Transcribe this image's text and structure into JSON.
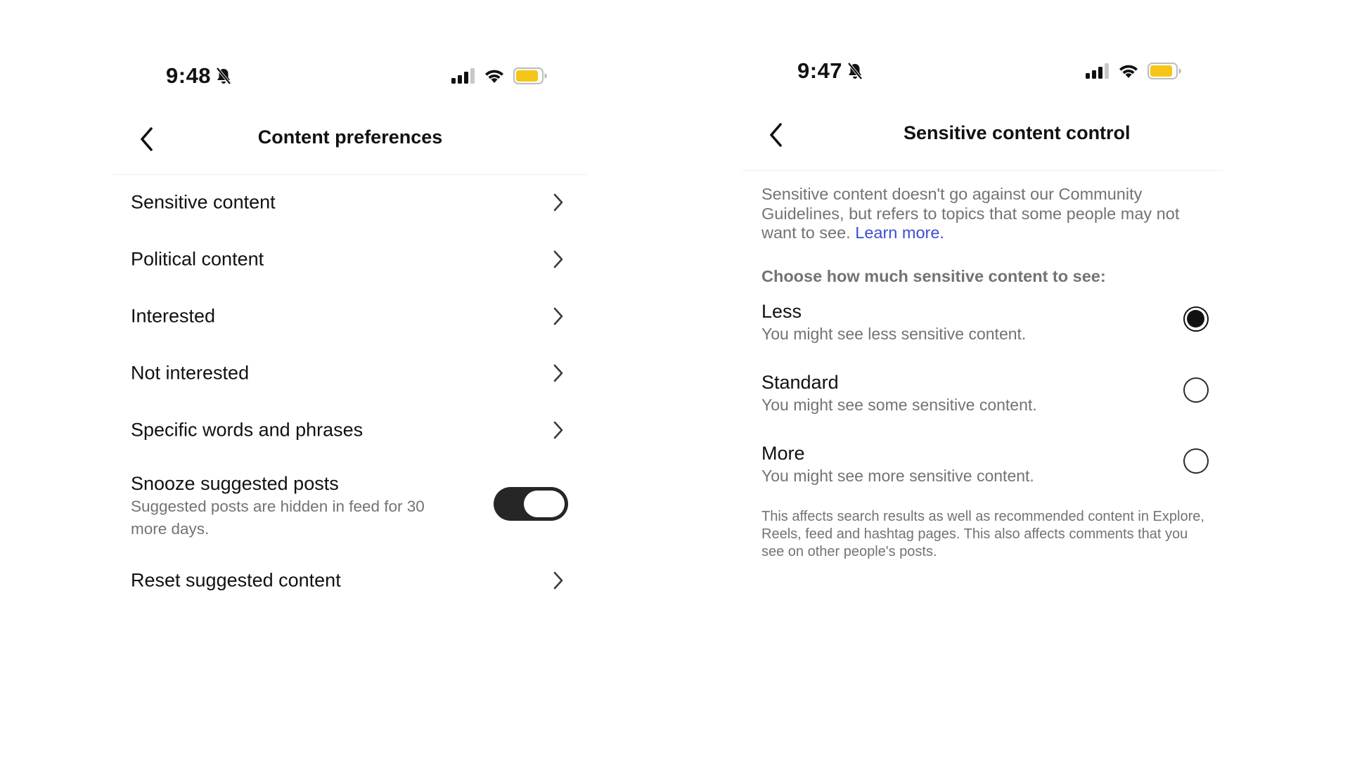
{
  "left_screen": {
    "status_bar": {
      "time": "9:48",
      "icons": [
        "bell-slash-icon",
        "signal-icon",
        "wifi-icon",
        "battery-icon"
      ]
    },
    "header": {
      "back_icon": "chevron-left-icon",
      "title": "Content preferences"
    },
    "items": [
      {
        "label": "Sensitive content"
      },
      {
        "label": "Political content"
      },
      {
        "label": "Interested"
      },
      {
        "label": "Not interested"
      },
      {
        "label": "Specific words and phrases"
      }
    ],
    "snooze": {
      "title": "Snooze suggested posts",
      "subtitle": "Suggested posts are hidden in feed for 30 more days.",
      "toggle_on": true
    },
    "reset": {
      "label": "Reset suggested content"
    }
  },
  "right_screen": {
    "status_bar": {
      "time": "9:47",
      "icons": [
        "bell-slash-icon",
        "signal-icon",
        "wifi-icon",
        "battery-icon"
      ]
    },
    "header": {
      "back_icon": "chevron-left-icon",
      "title": "Sensitive content control"
    },
    "description": "Sensitive content doesn't go against our Community Guidelines, but refers to topics that some people may not want to see.",
    "learn_more": "Learn more.",
    "choose_label": "Choose how much sensitive content to see:",
    "options": [
      {
        "label": "Less",
        "sub": "You might see less sensitive content.",
        "selected": true
      },
      {
        "label": "Standard",
        "sub": "You might see some sensitive content.",
        "selected": false
      },
      {
        "label": "More",
        "sub": "You might see more sensitive content.",
        "selected": false
      }
    ],
    "footnote": "This affects search results as well as recommended content in Explore, Reels, feed and hashtag pages. This also affects comments that you see on other people's posts."
  },
  "colors": {
    "battery_fill": "#f5c518",
    "link": "#3b4fd0",
    "secondary_text": "#737373",
    "toggle_on": "#262626"
  }
}
